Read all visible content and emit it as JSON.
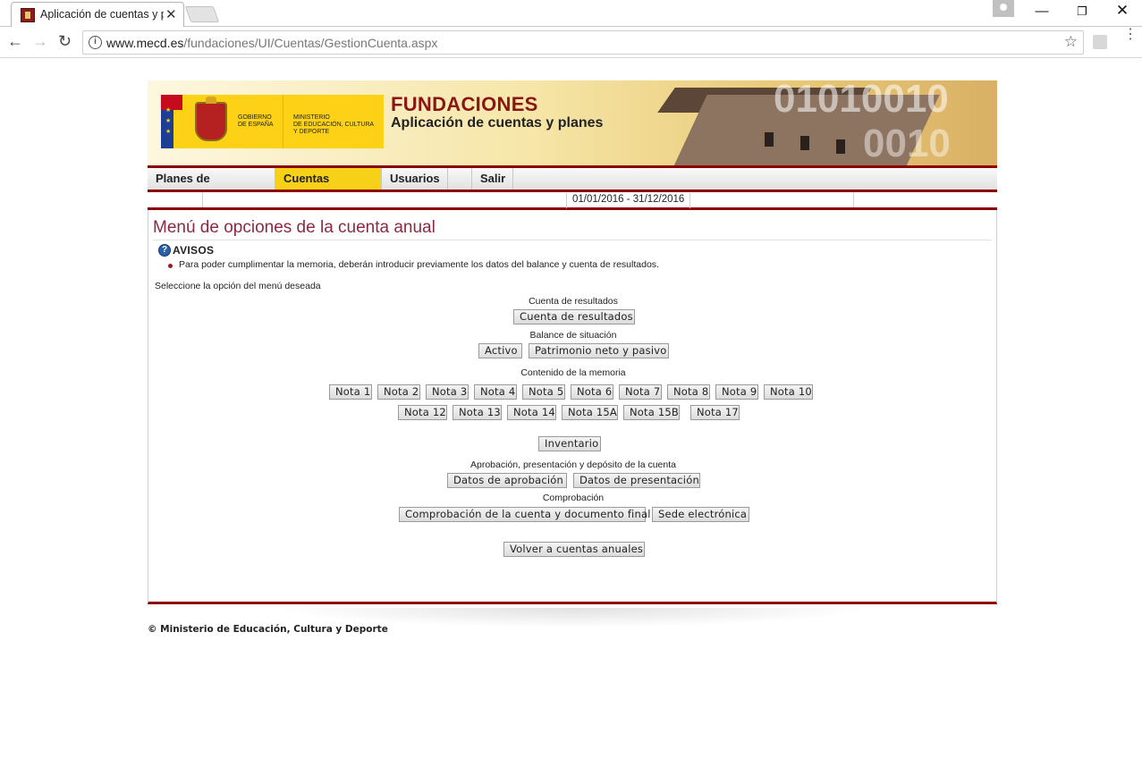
{
  "browser": {
    "tab_title": "Aplicación de cuentas y p",
    "tab_close": "✕",
    "url_host": "www.mecd.es",
    "url_path": "/fundaciones/UI/Cuentas/GestionCuenta.aspx",
    "nav_back": "←",
    "nav_forward": "→",
    "nav_reload": "↻",
    "star": "☆",
    "menu": "⋮",
    "window_minimize": "—",
    "window_maximize": "❐",
    "window_close": "✕"
  },
  "header": {
    "gov_text_1": "GOBIERNO",
    "gov_text_2": "DE ESPAÑA",
    "ministry_1": "MINISTERIO",
    "ministry_2": "DE EDUCACIÓN, CULTURA",
    "ministry_3": "Y DEPORTE",
    "title": "FUNDACIONES",
    "subtitle": "Aplicación de cuentas y planes",
    "binary_1": "01010010",
    "binary_2": "0010"
  },
  "menu": {
    "items": [
      {
        "label": "Planes de actuación",
        "active": false
      },
      {
        "label": "Cuentas anuales",
        "active": true
      },
      {
        "label": "Usuarios",
        "active": false
      },
      {
        "label": "Salir",
        "active": false
      }
    ]
  },
  "infobar": {
    "period": "01/01/2016 - 31/12/2016"
  },
  "main": {
    "heading": "Menú de opciones de la cuenta anual",
    "avisos_icon": "?",
    "avisos_title": "AVISOS",
    "avisos_message": "Para poder cumplimentar la memoria, deberán introducir previamente los datos del balance y cuenta de resultados.",
    "select_prompt": "Seleccione la opción del menú deseada",
    "sections": {
      "cuenta_resultados_label": "Cuenta de resultados",
      "cuenta_resultados_button": "Cuenta de resultados",
      "balance_label": "Balance de situación",
      "activo_button": "Activo",
      "patrimonio_button": "Patrimonio neto y pasivo",
      "memoria_label": "Contenido de la memoria",
      "notas_row1": [
        "Nota 1",
        "Nota 2",
        "Nota 3",
        "Nota 4",
        "Nota 5",
        "Nota 6",
        "Nota 7",
        "Nota 8",
        "Nota 9",
        "Nota 10"
      ],
      "notas_row2": [
        "Nota 12",
        "Nota 13",
        "Nota 14",
        "Nota 15A",
        "Nota 15B",
        "Nota 17"
      ],
      "inventario_button": "Inventario",
      "aprobacion_label": "Aprobación, presentación y depósito de la cuenta",
      "datos_aprobacion_button": "Datos de aprobación",
      "datos_presentacion_button": "Datos de presentación",
      "comprobacion_label": "Comprobación",
      "comprobacion_button": "Comprobación de la cuenta y documento final",
      "sede_button": "Sede electrónica",
      "volver_button": "Volver a cuentas anuales"
    }
  },
  "footer": {
    "copyright": "© Ministerio de Educación, Cultura y Deporte"
  },
  "colors": {
    "accent_red": "#8b0000",
    "active_menu": "#f7d117",
    "heading": "#8a2a44"
  }
}
